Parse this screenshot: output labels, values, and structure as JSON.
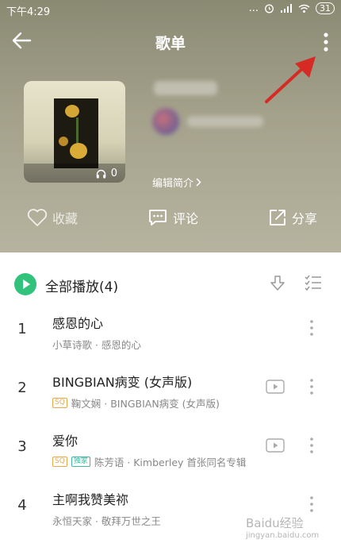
{
  "status_bar": {
    "time": "下午4:29",
    "signal": "...",
    "battery": "31"
  },
  "header": {
    "title": "歌单"
  },
  "cover": {
    "plays": "0"
  },
  "playlist_info": {
    "edit_intro": "编辑简介"
  },
  "actions": {
    "collect": "收藏",
    "comment": "评论",
    "share": "分享"
  },
  "play_all": {
    "label": "全部播放(4)"
  },
  "songs": [
    {
      "index": "1",
      "title": "感恩的心",
      "artist_album": "小草诗歌 · 感恩的心",
      "tags": [],
      "has_mv": false
    },
    {
      "index": "2",
      "title": "BINGBIAN病变 (女声版)",
      "artist_album": "鞠文娴 · BINGBIAN病变 (女声版)",
      "tags": [
        "SQ"
      ],
      "has_mv": true
    },
    {
      "index": "3",
      "title": "爱你",
      "artist_album": "陈芳语 · Kimberley 首张同名专辑",
      "tags": [
        "SQ",
        "独家"
      ],
      "has_mv": true
    },
    {
      "index": "4",
      "title": "主啊我赞美祢",
      "artist_album": "永恒天家 · 敬拜万世之王",
      "tags": [],
      "has_mv": false
    }
  ],
  "watermark": {
    "main": "Baidu经验",
    "sub": "jingyan.baidu.com"
  },
  "colors": {
    "accent": "#31c27c",
    "annotation_arrow": "#d62a24"
  }
}
